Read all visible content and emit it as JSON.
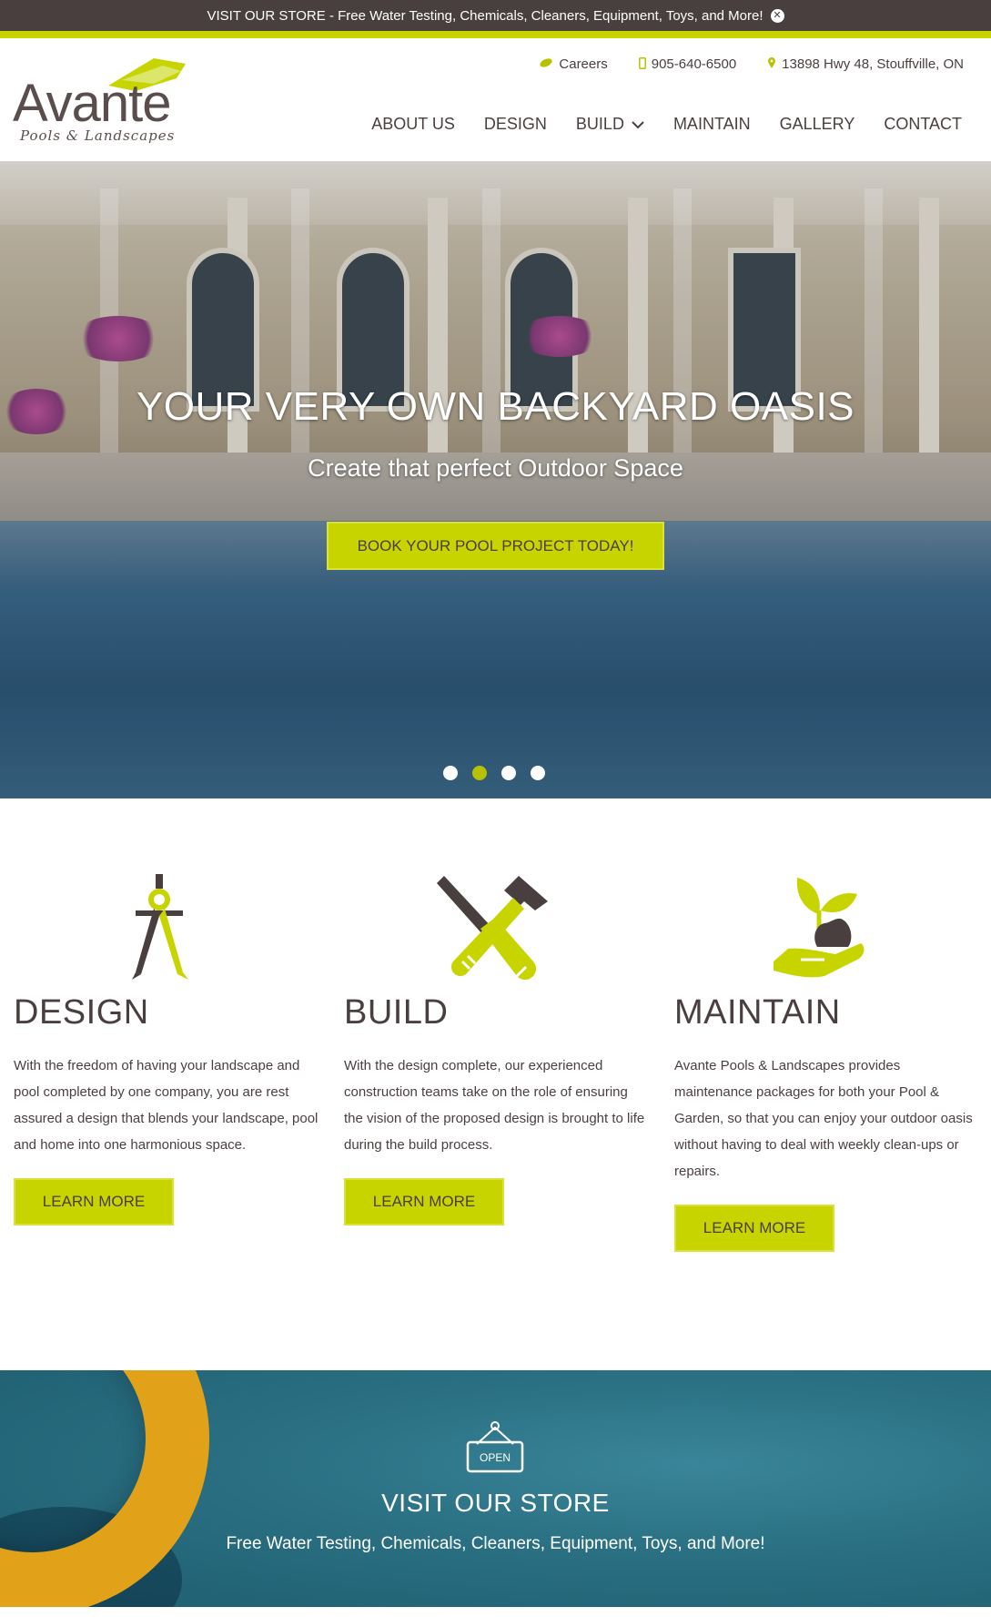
{
  "topbar": {
    "text": "VISIT OUR STORE - Free Water Testing, Chemicals, Cleaners, Equipment, Toys, and More!",
    "close_icon": "close-circle-icon"
  },
  "logo": {
    "word": "Avante",
    "tagline": "Pools & Landscapes"
  },
  "util": {
    "careers": "Careers",
    "phone": "905-640-6500",
    "address": "13898 Hwy 48, Stouffville, ON"
  },
  "nav": {
    "about": "ABOUT US",
    "design": "DESIGN",
    "build": "BUILD",
    "maintain": "MAINTAIN",
    "gallery": "GALLERY",
    "contact": "CONTACT"
  },
  "hero": {
    "title": "YOUR VERY OWN BACKYARD OASIS",
    "subtitle": "Create that perfect Outdoor Space",
    "cta": "BOOK YOUR POOL PROJECT TODAY!",
    "slides": 4,
    "active_slide": 2
  },
  "services": [
    {
      "title": "DESIGN",
      "body": "With the freedom of having your landscape and pool completed by one company, you are rest assured a design that blends your landscape, pool and home into one harmonious space.",
      "button": "LEARN MORE",
      "icon": "compass-icon"
    },
    {
      "title": "BUILD",
      "body": "With the design complete, our experienced construction teams take on the role of ensuring the vision of the proposed design is brought to life during the build process.",
      "button": "LEARN MORE",
      "icon": "tools-icon"
    },
    {
      "title": "MAINTAIN",
      "body": "Avante Pools & Landscapes provides maintenance packages for both your Pool & Garden, so that you can enjoy your outdoor oasis without having to deal with weekly clean-ups or repairs.",
      "button": "LEARN MORE",
      "icon": "plant-hand-icon"
    }
  ],
  "store": {
    "sign": "OPEN",
    "title": "VISIT OUR STORE",
    "line": "Free Water Testing, Chemicals, Cleaners, Equipment, Toys, and More!"
  },
  "colors": {
    "accent": "#c8d400",
    "dark": "#4a3f3f",
    "teal": "#2a6f82"
  }
}
